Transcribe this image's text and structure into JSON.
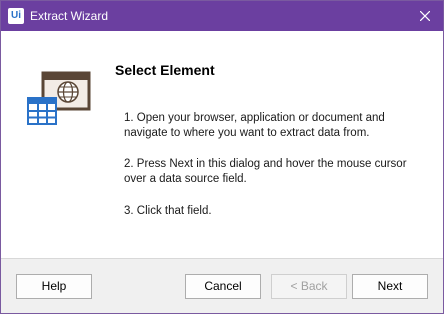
{
  "window": {
    "title": "Extract Wizard",
    "app_icon_text": "Ui",
    "accent_color": "#6b3fa0"
  },
  "content": {
    "heading": "Select Element",
    "steps": [
      "1. Open your browser, application or document and navigate to where you want to extract data from.",
      "2. Press Next in this dialog and hover the mouse cursor over a data source field.",
      "3. Click that field."
    ],
    "illustration_icon": "browser-window-with-table-icon"
  },
  "footer": {
    "help_label": "Help",
    "cancel_label": "Cancel",
    "back_label": "< Back",
    "next_label": "Next",
    "back_disabled": true
  }
}
